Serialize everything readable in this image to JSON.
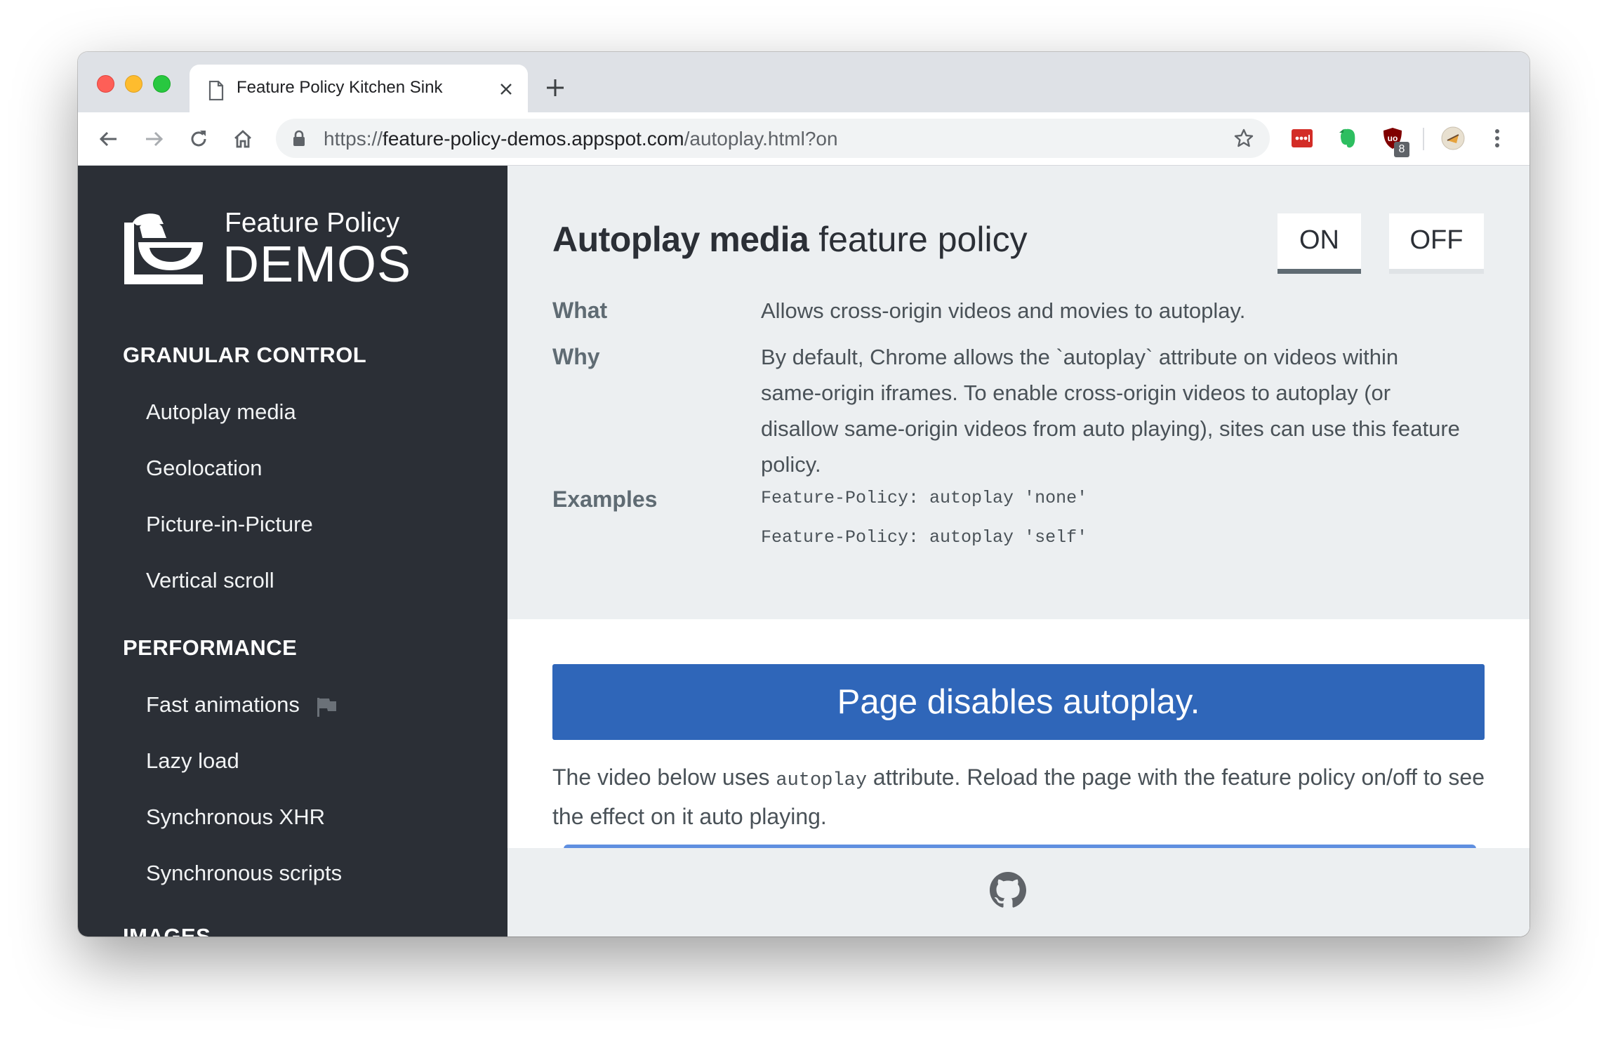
{
  "browser": {
    "tab_title": "Feature Policy Kitchen Sink",
    "url_scheme": "https://",
    "url_host": "feature-policy-demos.appspot.com",
    "url_path": "/autoplay.html?on",
    "extension_badge": "8"
  },
  "sidebar": {
    "brand_line1": "Feature Policy",
    "brand_line2": "DEMOS",
    "sections": [
      {
        "heading": "GRANULAR CONTROL",
        "items": [
          "Autoplay media",
          "Geolocation",
          "Picture-in-Picture",
          "Vertical scroll"
        ]
      },
      {
        "heading": "PERFORMANCE",
        "items": [
          "Fast animations",
          "Lazy load",
          "Synchronous XHR",
          "Synchronous scripts"
        ]
      },
      {
        "heading": "IMAGES"
      }
    ]
  },
  "policy": {
    "title_bold": "Autoplay media",
    "title_rest": " feature policy",
    "toggle_on": "ON",
    "toggle_off": "OFF",
    "what_label": "What",
    "what_text": "Allows cross-origin videos and movies to autoplay.",
    "why_label": "Why",
    "why_text": "By default, Chrome allows the `autoplay` attribute on videos within same-origin iframes. To enable cross-origin videos to autoplay (or disallow same-origin videos from auto playing), sites can use this feature policy.",
    "examples_label": "Examples",
    "examples": [
      "Feature-Policy: autoplay 'none'",
      "Feature-Policy: autoplay 'self'"
    ]
  },
  "content": {
    "banner": "Page disables autoplay.",
    "desc_before": "The video below uses ",
    "desc_code": "autoplay",
    "desc_after": " attribute. Reload the page with the feature policy on/off to see the effect on it auto playing."
  },
  "colors": {
    "sidebar_bg": "#2b2f36",
    "panel_bg": "#eceff1",
    "banner_bg": "#2f66b9",
    "toggle_active_underline": "#5f6b73"
  },
  "icons": [
    "document-icon",
    "close-icon",
    "plus-icon",
    "back-icon",
    "forward-icon",
    "reload-icon",
    "home-icon",
    "lock-icon",
    "star-icon",
    "lastpass-icon",
    "evernote-icon",
    "ublock-icon",
    "profile-icon",
    "menu-icon",
    "chef-logo-icon",
    "flag-icon",
    "github-icon"
  ]
}
